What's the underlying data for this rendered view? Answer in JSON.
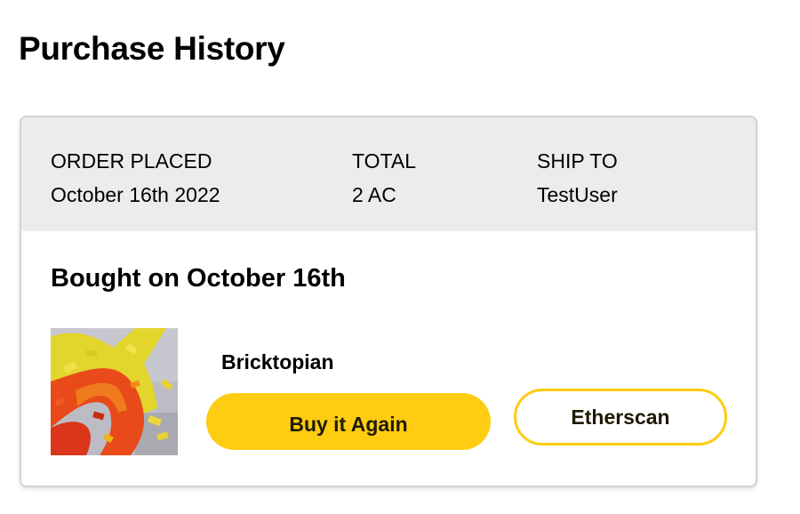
{
  "page": {
    "title": "Purchase History"
  },
  "order": {
    "header": {
      "order_placed_label": "ORDER PLACED",
      "order_placed_value": "October 16th 2022",
      "total_label": "TOTAL",
      "total_value": "2 AC",
      "ship_to_label": "SHIP TO",
      "ship_to_value": "TestUser"
    },
    "bought_heading": "Bought on October 16th",
    "item": {
      "name": "Bricktopian",
      "image_icon": "brick-sculpture-thumbnail",
      "buy_again_label": "Buy it Again",
      "etherscan_label": "Etherscan"
    }
  },
  "colors": {
    "accent_yellow": "#fecc11",
    "header_bg": "#ebecee",
    "card_border": "#d2d3d6",
    "button_text": "#1e1a05"
  }
}
